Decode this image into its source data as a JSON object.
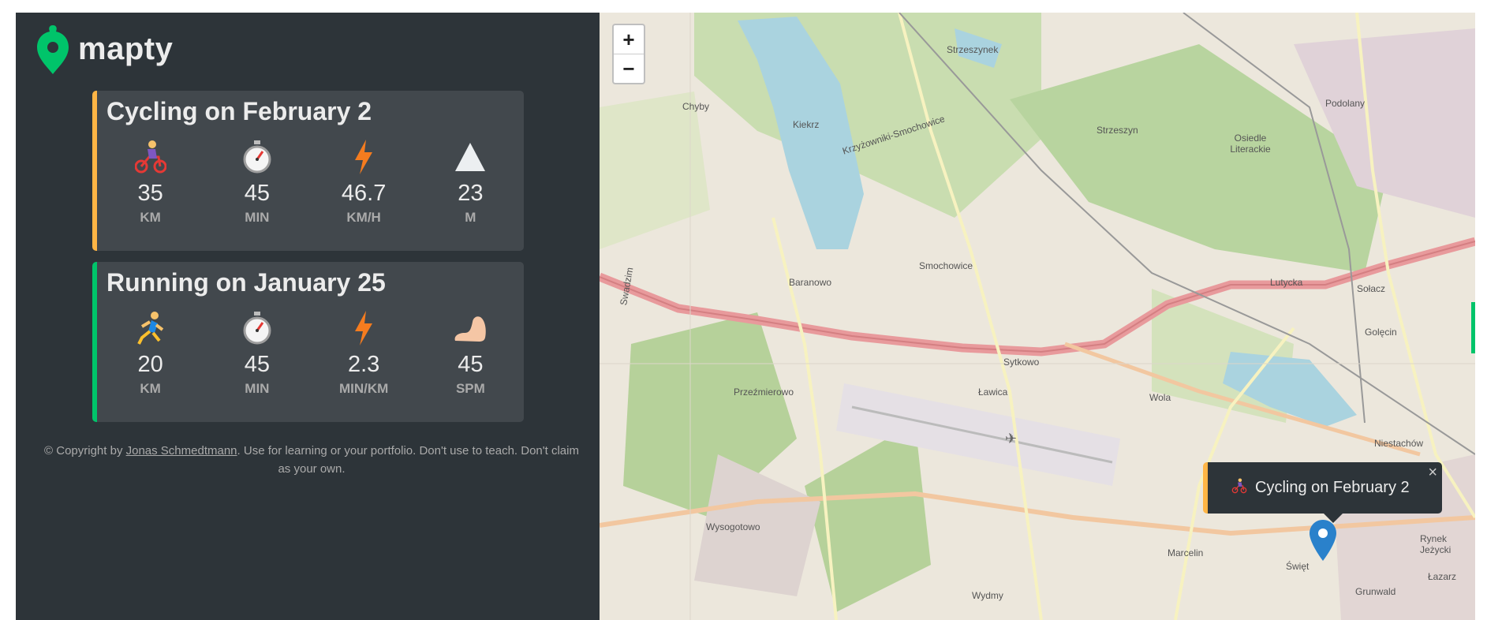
{
  "app": {
    "logo_text": "mapty",
    "brand_green": "#00c46a",
    "brand_orange": "#ffb545"
  },
  "workouts": [
    {
      "type": "cycling",
      "title": "Cycling on February 2",
      "details": [
        {
          "icon": "cyclist-icon",
          "value": "35",
          "unit": "KM"
        },
        {
          "icon": "stopwatch-icon",
          "value": "45",
          "unit": "MIN"
        },
        {
          "icon": "lightning-icon",
          "value": "46.7",
          "unit": "KM/H"
        },
        {
          "icon": "mountain-icon",
          "value": "23",
          "unit": "M"
        }
      ]
    },
    {
      "type": "running",
      "title": "Running on January 25",
      "details": [
        {
          "icon": "runner-icon",
          "value": "20",
          "unit": "KM"
        },
        {
          "icon": "stopwatch-icon",
          "value": "45",
          "unit": "MIN"
        },
        {
          "icon": "lightning-icon",
          "value": "2.3",
          "unit": "MIN/KM"
        },
        {
          "icon": "foot-icon",
          "value": "45",
          "unit": "SPM"
        }
      ]
    }
  ],
  "copyright": {
    "prefix": "© Copyright by ",
    "author": "Jonas Schmedtmann",
    "suffix": ". Use for learning or your portfolio. Don't use to teach. Don't claim as your own."
  },
  "map": {
    "zoom_in": "+",
    "zoom_out": "−",
    "popup_text": "Cycling on February 2",
    "popup_close": "×",
    "labels": [
      {
        "text": "Strzeszynek"
      },
      {
        "text": "Podolany"
      },
      {
        "text": "Strzeszyn"
      },
      {
        "text": "Osiedle Literackie"
      },
      {
        "text": "Chyby"
      },
      {
        "text": "Kiekrz"
      },
      {
        "text": "Krzyżowniki-Smochowice"
      },
      {
        "text": "Smochowice"
      },
      {
        "text": "Baranowo"
      },
      {
        "text": "Lutycka"
      },
      {
        "text": "Sołacz"
      },
      {
        "text": "Golęcin"
      },
      {
        "text": "Sytkowo"
      },
      {
        "text": "Przeźmierowo"
      },
      {
        "text": "Ławica"
      },
      {
        "text": "Wola"
      },
      {
        "text": "Niestachów"
      },
      {
        "text": "Wysogotowo"
      },
      {
        "text": "Marcelin"
      },
      {
        "text": "Święt"
      },
      {
        "text": "Wydmy"
      },
      {
        "text": "Grunwald"
      },
      {
        "text": "Rynek Jeżycki"
      },
      {
        "text": "Łazarz"
      },
      {
        "text": "Swadzim"
      }
    ]
  }
}
